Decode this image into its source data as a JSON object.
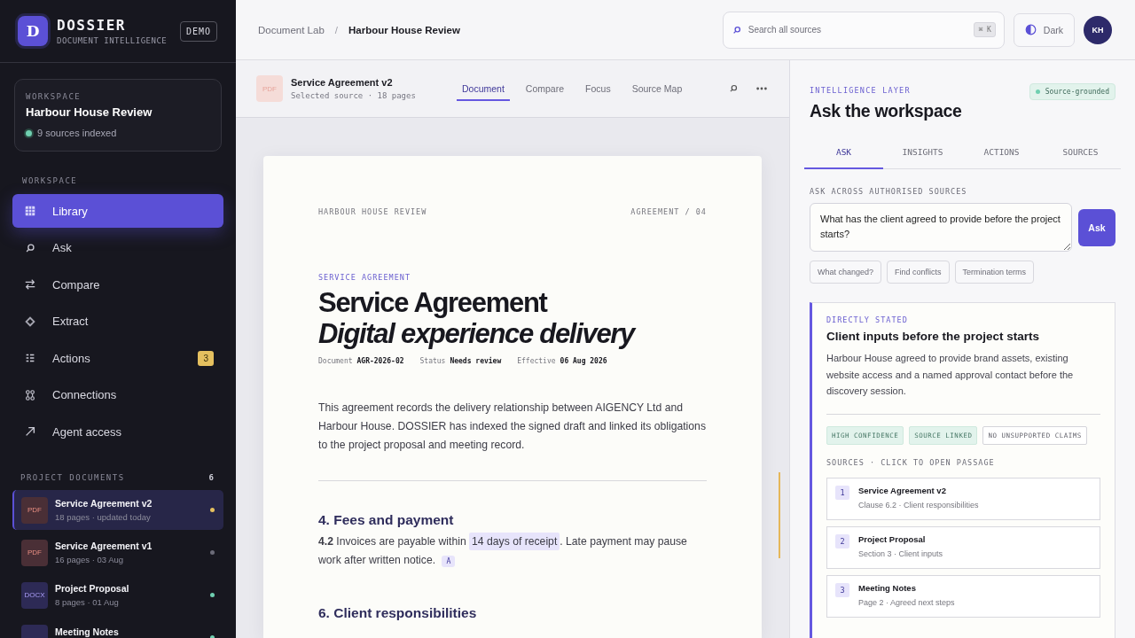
{
  "brand": {
    "logo_letter": "D",
    "name": "DOSSIER",
    "tagline": "DOCUMENT INTELLIGENCE",
    "badge": "DEMO"
  },
  "workspace_card": {
    "label": "WORKSPACE",
    "name": "Harbour House Review",
    "status": "9 sources indexed"
  },
  "nav": {
    "heading": "WORKSPACE",
    "items": [
      {
        "label": "Library",
        "selected": true
      },
      {
        "label": "Ask",
        "selected": false
      },
      {
        "label": "Compare",
        "selected": false
      },
      {
        "label": "Extract",
        "selected": false
      },
      {
        "label": "Actions",
        "selected": false,
        "badge": "3"
      },
      {
        "label": "Connections",
        "selected": false
      },
      {
        "label": "Agent access",
        "selected": false
      }
    ]
  },
  "documents": {
    "heading": "PROJECT DOCUMENTS",
    "count": "6",
    "items": [
      {
        "kind": "pdf",
        "type": "PDF",
        "name": "Service Agreement v2",
        "meta": "18 pages · updated today",
        "selected": true,
        "color": "#e5c05f"
      },
      {
        "kind": "pdf",
        "type": "PDF",
        "name": "Service Agreement v1",
        "meta": "16 pages · 03 Aug",
        "selected": false,
        "color": "#6b6b78"
      },
      {
        "kind": "docx",
        "type": "DOCX",
        "name": "Project Proposal",
        "meta": "8 pages · 01 Aug",
        "selected": false,
        "color": "#6fcfb0"
      },
      {
        "kind": "docx",
        "name": "Meeting Notes",
        "selected": false,
        "color": "#6fcfb0"
      }
    ]
  },
  "topbar": {
    "breadcrumb": [
      "Document Lab",
      "Harbour House Review"
    ],
    "breadcrumb_separator": "/",
    "search": {
      "placeholder": "Search all sources",
      "shortcut": "⌘ K"
    },
    "theme_button": "Dark",
    "avatar": "KH"
  },
  "document_header": {
    "type": "PDF",
    "title": "Service Agreement v2",
    "subtitle": "Selected source · 18 pages",
    "tabs": [
      {
        "label": "Document",
        "selected": true
      },
      {
        "label": "Compare",
        "selected": false
      },
      {
        "label": "Focus",
        "selected": false
      },
      {
        "label": "Source Map",
        "selected": false
      }
    ]
  },
  "document": {
    "running_head": "HARBOUR HOUSE REVIEW",
    "reference": "AGREEMENT / 04",
    "eyebrow": "SERVICE AGREEMENT",
    "title": "Service Agreement",
    "subtitle": "Digital experience delivery",
    "meta": [
      {
        "label": "Document",
        "value": "AGR-2026-02"
      },
      {
        "label": "Status",
        "value": "Needs review"
      },
      {
        "label": "Effective",
        "value": "06 Aug 2026"
      }
    ],
    "intro": "This agreement records the delivery relationship between AIGENCY Ltd and Harbour House. DOSSIER has indexed the signed draft and linked its obligations to the project proposal and meeting record.",
    "sections": [
      {
        "heading": "4. Fees and payment",
        "clause": {
          "number": "4.2",
          "before": "Invoices are payable within",
          "highlight": "14 days of receipt",
          "after": ". Late payment may pause work after written notice.",
          "citation": "A"
        }
      },
      {
        "heading": "6. Client responsibilities"
      }
    ]
  },
  "ask_panel": {
    "eyebrow": "INTELLIGENCE LAYER",
    "badge": "Source-grounded",
    "title": "Ask the workspace",
    "tabs": [
      {
        "label": "ASK",
        "selected": true
      },
      {
        "label": "INSIGHTS",
        "selected": false
      },
      {
        "label": "ACTIONS",
        "selected": false
      },
      {
        "label": "SOURCES",
        "selected": false
      }
    ],
    "field_label": "ASK ACROSS AUTHORISED SOURCES",
    "question": "What has the client agreed to provide before the project starts?",
    "ask_button": "Ask",
    "suggestions": [
      "What changed?",
      "Find conflicts",
      "Termination terms"
    ],
    "answer": {
      "label": "DIRECTLY STATED",
      "title": "Client inputs before the project starts",
      "body": "Harbour House agreed to provide brand assets, existing website access and a named approval contact before the discovery session.",
      "tags": [
        {
          "label": "HIGH CONFIDENCE",
          "kind": "positive"
        },
        {
          "label": "SOURCE LINKED",
          "kind": "positive"
        },
        {
          "label": "NO UNSUPPORTED CLAIMS",
          "kind": "neutral"
        }
      ],
      "sources_label": "SOURCES · CLICK TO OPEN PASSAGE",
      "sources": [
        {
          "number": "1",
          "title": "Service Agreement v2",
          "detail": "Clause 6.2 · Client responsibilities"
        },
        {
          "number": "2",
          "title": "Project Proposal",
          "detail": "Section 3 · Client inputs"
        },
        {
          "number": "3",
          "title": "Meeting Notes",
          "detail": "Page 2 · Agreed next steps"
        }
      ]
    }
  }
}
